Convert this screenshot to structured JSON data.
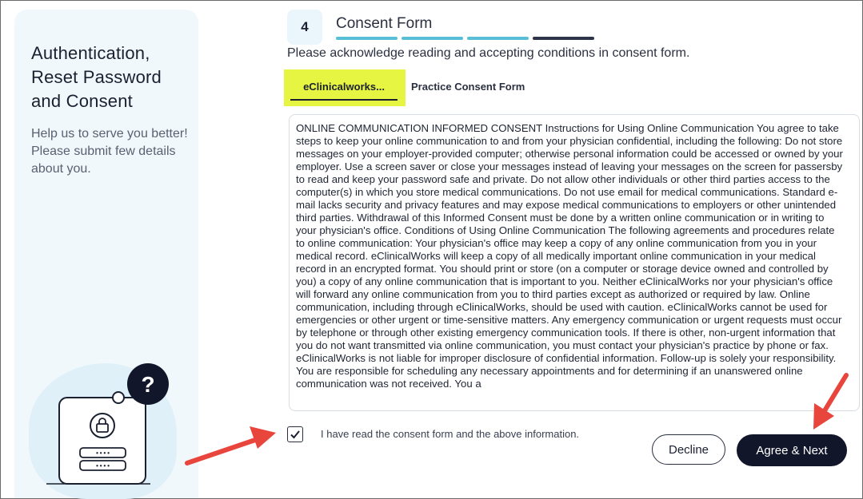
{
  "sidebar": {
    "title": "Authentication, Reset Password and Consent",
    "subtitle": "Help us to serve you better! Please submit few details about you.",
    "illustration_icons": [
      "question-mark-icon",
      "lock-icon",
      "password-field-icon"
    ],
    "question_mark": "?",
    "password_dots": "••••"
  },
  "step": {
    "number": "4",
    "title": "Consent Form",
    "progress_total": 4,
    "progress_current": 4
  },
  "instruction": "Please acknowledge reading and accepting conditions in consent form.",
  "tabs": [
    {
      "label": "eClinicalworks...",
      "active": true
    },
    {
      "label": "Practice Consent Form",
      "active": false
    }
  ],
  "consent_text": "ONLINE COMMUNICATION INFORMED CONSENT Instructions for Using Online Communication You agree to take steps to keep your online communication to and from your physician confidential, including the following: Do not store messages on your employer-provided computer; otherwise personal information could be accessed or owned by your employer. Use a screen saver or close your messages instead of leaving your messages on the screen for passersby to read and keep your password safe and private. Do not allow other individuals or other third parties access to the computer(s) in which you store medical communications. Do not use email for medical communications. Standard e-mail lacks security and privacy features and may expose medical communications to employers or other unintended third parties. Withdrawal of this Informed Consent must be done by a written online communication or in writing to your physician's office. Conditions of Using Online Communication The following agreements and procedures relate to online communication: Your physician's office may keep a copy of any online communication from you in your medical record. eClinicalWorks will keep a copy of all medically important online communication in your medical record in an encrypted format. You should print or store (on a computer or storage device owned and controlled by you) a copy of any online communication that is important to you. Neither eClinicalWorks nor your physician's office will forward any online communication from you to third parties except as authorized or required by law. Online communication, including through eClinicalWorks, should be used with caution. eClinicalWorks cannot be used for emergencies or other urgent or time-sensitive matters. Any emergency communication or urgent requests must occur by telephone or through other existing emergency communication tools. If there is other, non-urgent information that you do not want transmitted via online communication, you must contact your physician's practice by phone or fax. eClinicalWorks is not liable for improper disclosure of confidential information. Follow-up is solely your responsibility. You are responsible for scheduling any necessary appointments and for determining if an unanswered online communication was not received. You a",
  "acknowledge": {
    "checked": true,
    "label": "I have read the consent form and the above information."
  },
  "buttons": {
    "decline": "Decline",
    "agree": "Agree & Next"
  },
  "colors": {
    "accent_progress": "#59bfd9",
    "current_progress": "#2e3448",
    "tab_highlight": "#e6f542",
    "primary_button": "#11162a",
    "annotation_arrow": "#e8453c"
  }
}
